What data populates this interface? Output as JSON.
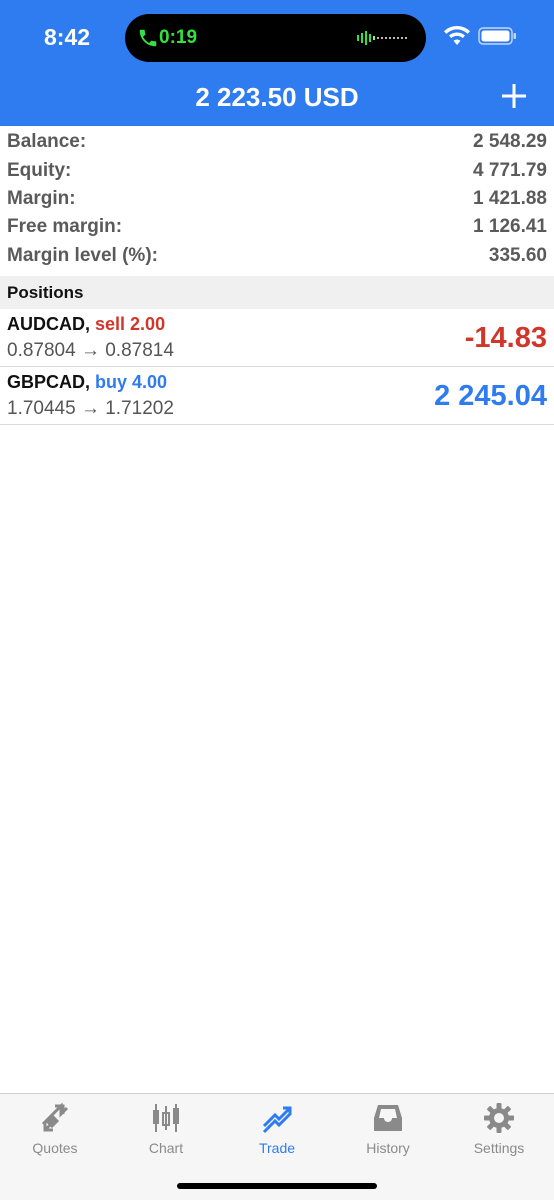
{
  "status_bar": {
    "time": "8:42",
    "call_duration": "0:19"
  },
  "header": {
    "title": "2 223.50 USD",
    "add_icon": "plus-icon"
  },
  "summary": [
    {
      "label": "Balance:",
      "value": "2 548.29"
    },
    {
      "label": "Equity:",
      "value": "4 771.79"
    },
    {
      "label": "Margin:",
      "value": "1 421.88"
    },
    {
      "label": "Free margin:",
      "value": "1 126.41"
    },
    {
      "label": "Margin level (%):",
      "value": "335.60"
    }
  ],
  "positions": {
    "header": "Positions",
    "items": [
      {
        "symbol": "AUDCAD,",
        "side": "sell 2.00",
        "prices": "0.87804 → 0.87814",
        "profit": "-14.83"
      },
      {
        "symbol": "GBPCAD,",
        "side": "buy 4.00",
        "prices": "1.70445 → 1.71202",
        "profit": "2 245.04"
      }
    ]
  },
  "tabs": [
    {
      "label": "Quotes",
      "icon": "quotes-arrows-icon",
      "active": false
    },
    {
      "label": "Chart",
      "icon": "candlestick-chart-icon",
      "active": false
    },
    {
      "label": "Trade",
      "icon": "trade-trend-icon",
      "active": true
    },
    {
      "label": "History",
      "icon": "history-inbox-icon",
      "active": false
    },
    {
      "label": "Settings",
      "icon": "gear-icon",
      "active": false
    }
  ],
  "colors": {
    "accent": "#2f7bf0",
    "sell": "#d0372a",
    "call_green": "#34e23f"
  }
}
